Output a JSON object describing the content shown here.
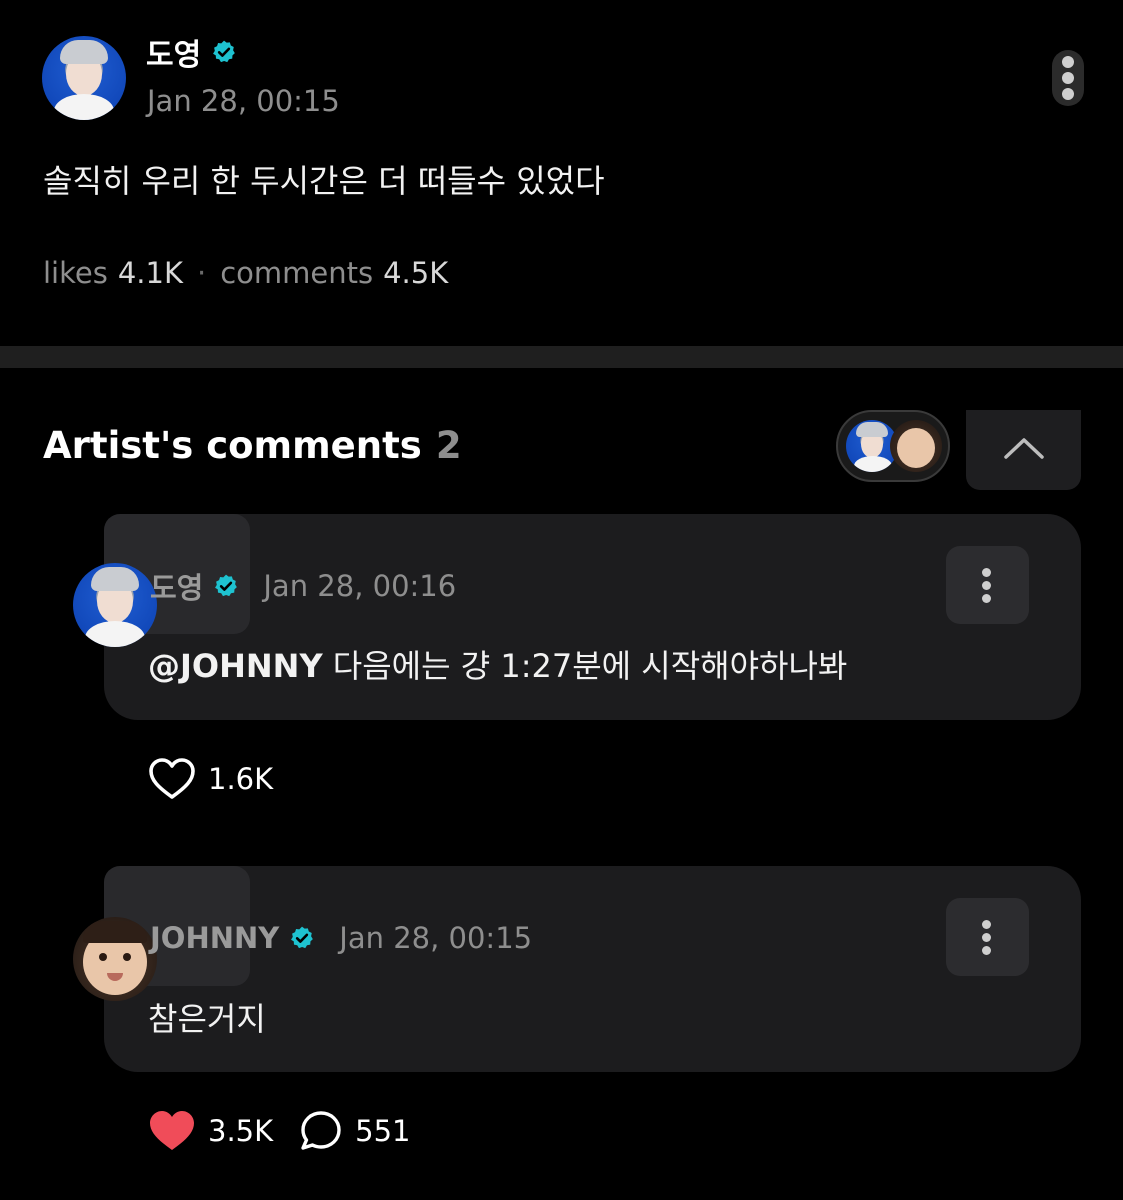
{
  "post": {
    "author": "도영",
    "timestamp": "Jan 28, 00:15",
    "text": "솔직히 우리 한 두시간은 더 떠들수 있었다",
    "likes_label": "likes",
    "likes_count": "4.1K",
    "separator": "·",
    "comments_label": "comments",
    "comments_count": "4.5K"
  },
  "artist_comments": {
    "title": "Artist's comments",
    "count": "2"
  },
  "comments": [
    {
      "author": "도영",
      "timestamp": "Jan 28, 00:16",
      "mention": "@JOHNNY",
      "text": " 다음에는 걍 1:27분에 시작해야하나봐",
      "likes": "1.6K"
    },
    {
      "author": "JOHNNY",
      "timestamp": "Jan 28, 00:15",
      "text": "참은거지",
      "likes": "3.5K",
      "replies": "551"
    }
  ],
  "colors": {
    "background": "#000000",
    "verified": "#1ec2d0",
    "bubble": "#1c1c1e",
    "muted_text": "#8b8b8b",
    "liked_heart": "#f04c59"
  },
  "icons": [
    "verified-badge-icon",
    "more-options-icon",
    "chevron-up-icon",
    "heart-outline-icon",
    "heart-filled-icon",
    "comment-bubble-icon"
  ]
}
